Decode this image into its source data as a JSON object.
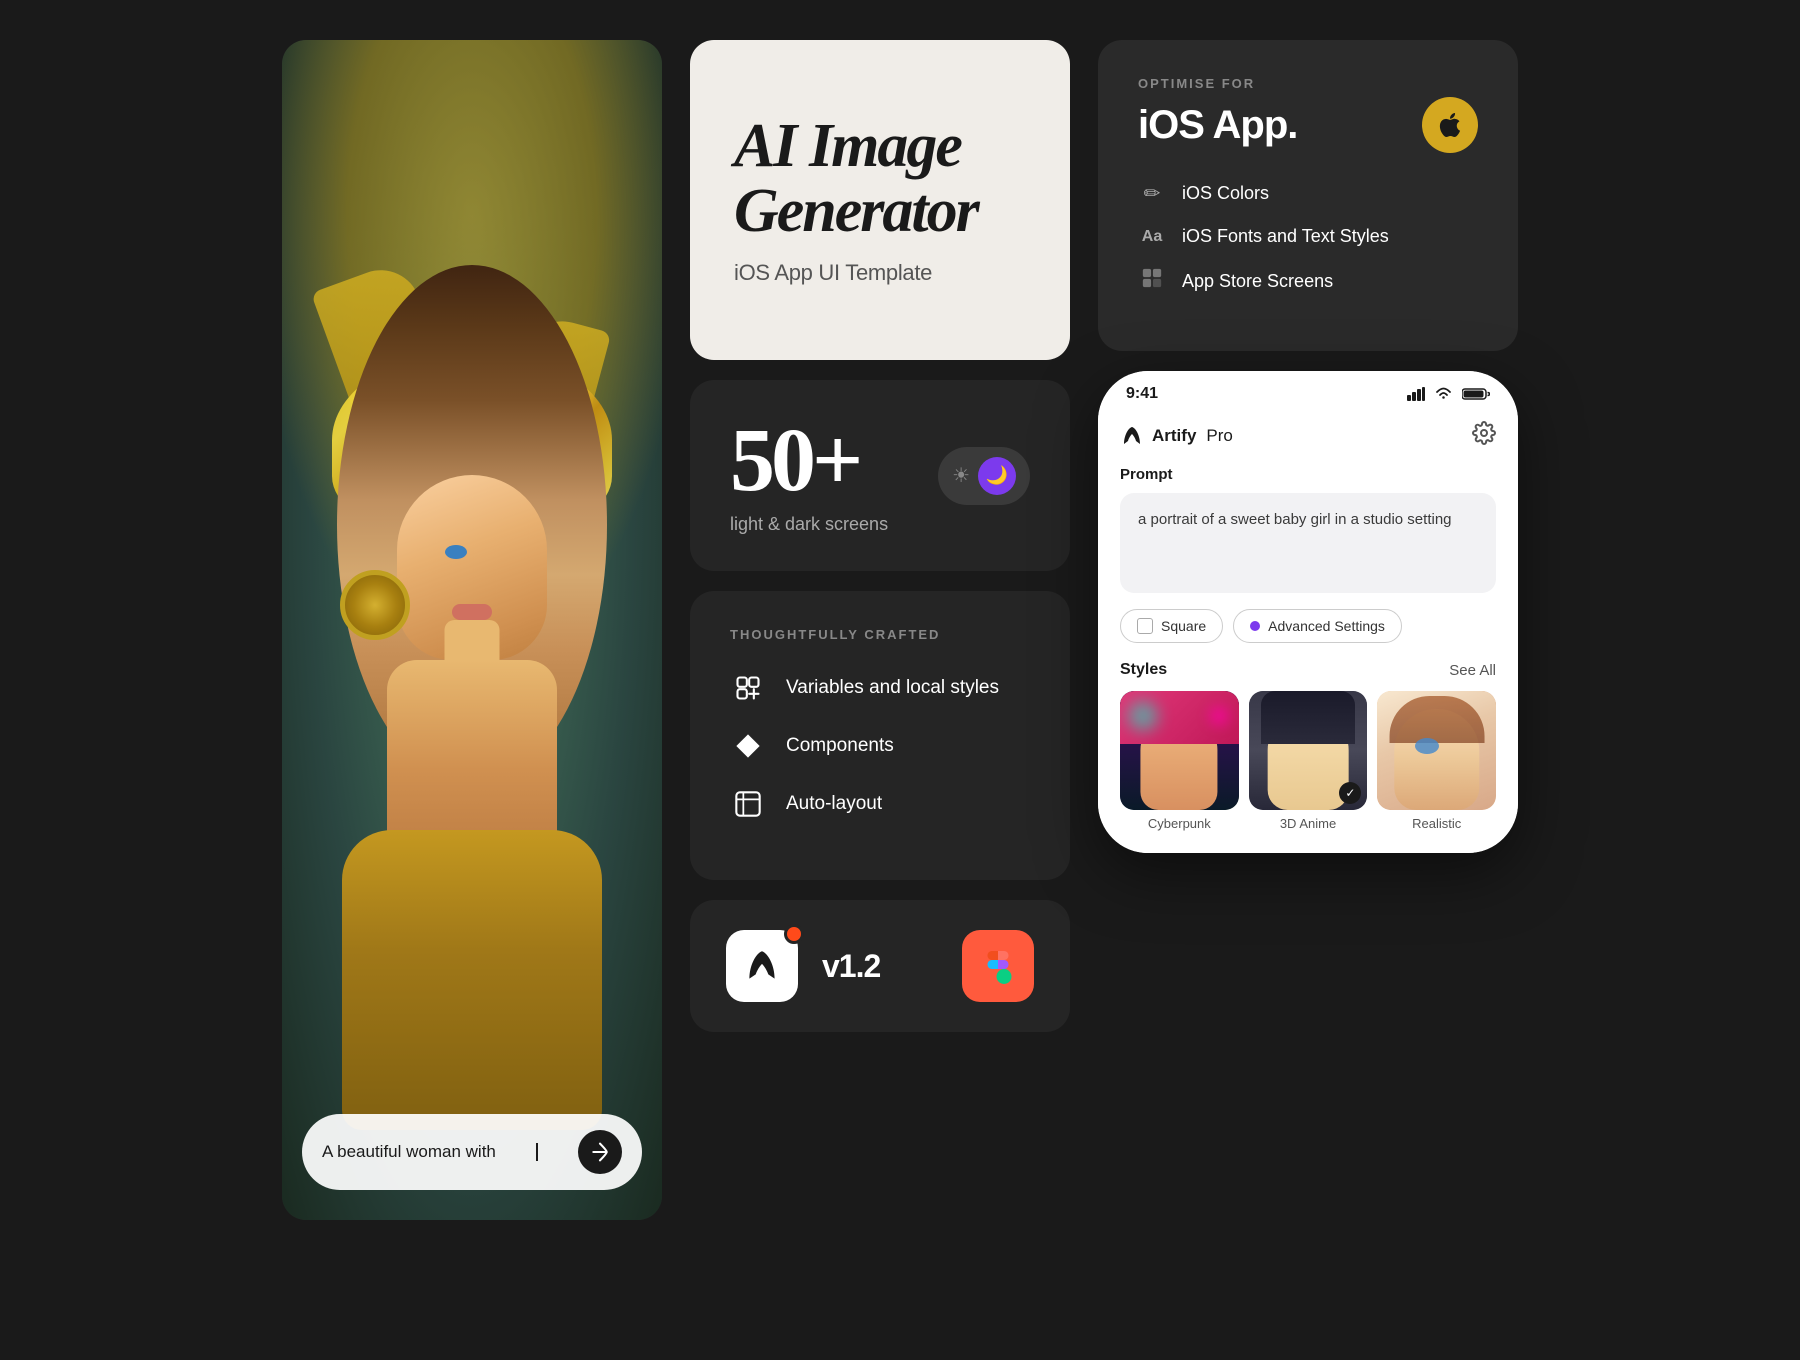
{
  "hero": {
    "prompt_text": "A beautiful woman with",
    "send_label": "→"
  },
  "middle": {
    "title_card": {
      "line1": "AI Image",
      "line2": "Generator",
      "subtitle": "iOS App UI Template"
    },
    "stats": {
      "number": "50+",
      "label": "light & dark screens"
    },
    "theme_toggle": {
      "sun": "☀",
      "moon": "🌙"
    },
    "features": {
      "label": "THOUGHTFULLY CRAFTED",
      "items": [
        {
          "icon": "⬡",
          "text": "Variables and local styles"
        },
        {
          "icon": "◆",
          "text": "Components"
        },
        {
          "icon": "⊡",
          "text": "Auto-layout"
        }
      ]
    },
    "bottom_bar": {
      "version": "v1.2"
    }
  },
  "right": {
    "ios_panel": {
      "optimise_label": "OPTIMISE FOR",
      "title": "iOS App.",
      "apple_icon": "",
      "features": [
        {
          "icon": "✏",
          "text": "iOS Colors"
        },
        {
          "icon": "Aa",
          "text": "iOS Fonts and Text Styles"
        },
        {
          "icon": "⊞",
          "text": "App Store Screens"
        }
      ]
    },
    "phone": {
      "status_time": "9:41",
      "signal": "▲▲▲",
      "wifi": "◈",
      "battery": "▬",
      "brand": "Artify",
      "brand_sub": "Pro",
      "prompt_label": "Prompt",
      "prompt_text": "a portrait of a sweet baby girl in a studio setting",
      "square_label": "Square",
      "advanced_label": "Advanced Settings",
      "styles_title": "Styles",
      "see_all": "See All",
      "styles": [
        {
          "name": "Cyberpunk",
          "type": "cyberpunk"
        },
        {
          "name": "3D Anime",
          "type": "anime",
          "selected": true
        },
        {
          "name": "Realistic",
          "type": "realistic"
        }
      ]
    }
  }
}
